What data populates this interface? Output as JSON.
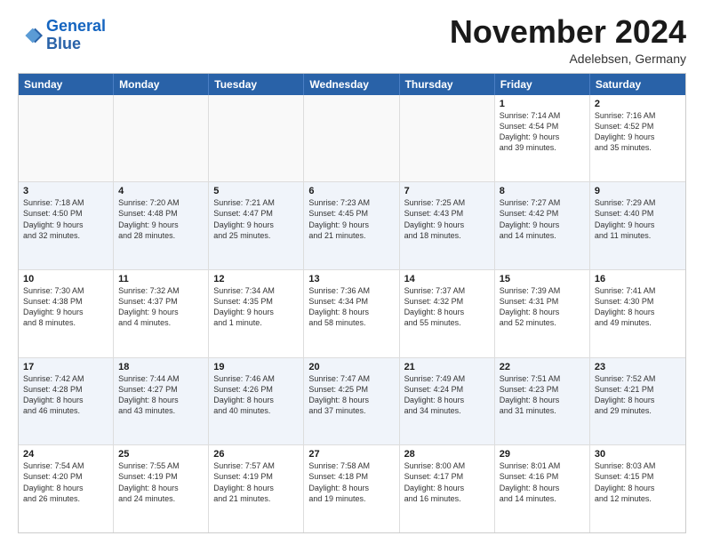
{
  "header": {
    "logo_line1": "General",
    "logo_line2": "Blue",
    "month": "November 2024",
    "location": "Adelebsen, Germany"
  },
  "weekdays": [
    "Sunday",
    "Monday",
    "Tuesday",
    "Wednesday",
    "Thursday",
    "Friday",
    "Saturday"
  ],
  "rows": [
    [
      {
        "day": "",
        "info": ""
      },
      {
        "day": "",
        "info": ""
      },
      {
        "day": "",
        "info": ""
      },
      {
        "day": "",
        "info": ""
      },
      {
        "day": "",
        "info": ""
      },
      {
        "day": "1",
        "info": "Sunrise: 7:14 AM\nSunset: 4:54 PM\nDaylight: 9 hours\nand 39 minutes."
      },
      {
        "day": "2",
        "info": "Sunrise: 7:16 AM\nSunset: 4:52 PM\nDaylight: 9 hours\nand 35 minutes."
      }
    ],
    [
      {
        "day": "3",
        "info": "Sunrise: 7:18 AM\nSunset: 4:50 PM\nDaylight: 9 hours\nand 32 minutes."
      },
      {
        "day": "4",
        "info": "Sunrise: 7:20 AM\nSunset: 4:48 PM\nDaylight: 9 hours\nand 28 minutes."
      },
      {
        "day": "5",
        "info": "Sunrise: 7:21 AM\nSunset: 4:47 PM\nDaylight: 9 hours\nand 25 minutes."
      },
      {
        "day": "6",
        "info": "Sunrise: 7:23 AM\nSunset: 4:45 PM\nDaylight: 9 hours\nand 21 minutes."
      },
      {
        "day": "7",
        "info": "Sunrise: 7:25 AM\nSunset: 4:43 PM\nDaylight: 9 hours\nand 18 minutes."
      },
      {
        "day": "8",
        "info": "Sunrise: 7:27 AM\nSunset: 4:42 PM\nDaylight: 9 hours\nand 14 minutes."
      },
      {
        "day": "9",
        "info": "Sunrise: 7:29 AM\nSunset: 4:40 PM\nDaylight: 9 hours\nand 11 minutes."
      }
    ],
    [
      {
        "day": "10",
        "info": "Sunrise: 7:30 AM\nSunset: 4:38 PM\nDaylight: 9 hours\nand 8 minutes."
      },
      {
        "day": "11",
        "info": "Sunrise: 7:32 AM\nSunset: 4:37 PM\nDaylight: 9 hours\nand 4 minutes."
      },
      {
        "day": "12",
        "info": "Sunrise: 7:34 AM\nSunset: 4:35 PM\nDaylight: 9 hours\nand 1 minute."
      },
      {
        "day": "13",
        "info": "Sunrise: 7:36 AM\nSunset: 4:34 PM\nDaylight: 8 hours\nand 58 minutes."
      },
      {
        "day": "14",
        "info": "Sunrise: 7:37 AM\nSunset: 4:32 PM\nDaylight: 8 hours\nand 55 minutes."
      },
      {
        "day": "15",
        "info": "Sunrise: 7:39 AM\nSunset: 4:31 PM\nDaylight: 8 hours\nand 52 minutes."
      },
      {
        "day": "16",
        "info": "Sunrise: 7:41 AM\nSunset: 4:30 PM\nDaylight: 8 hours\nand 49 minutes."
      }
    ],
    [
      {
        "day": "17",
        "info": "Sunrise: 7:42 AM\nSunset: 4:28 PM\nDaylight: 8 hours\nand 46 minutes."
      },
      {
        "day": "18",
        "info": "Sunrise: 7:44 AM\nSunset: 4:27 PM\nDaylight: 8 hours\nand 43 minutes."
      },
      {
        "day": "19",
        "info": "Sunrise: 7:46 AM\nSunset: 4:26 PM\nDaylight: 8 hours\nand 40 minutes."
      },
      {
        "day": "20",
        "info": "Sunrise: 7:47 AM\nSunset: 4:25 PM\nDaylight: 8 hours\nand 37 minutes."
      },
      {
        "day": "21",
        "info": "Sunrise: 7:49 AM\nSunset: 4:24 PM\nDaylight: 8 hours\nand 34 minutes."
      },
      {
        "day": "22",
        "info": "Sunrise: 7:51 AM\nSunset: 4:23 PM\nDaylight: 8 hours\nand 31 minutes."
      },
      {
        "day": "23",
        "info": "Sunrise: 7:52 AM\nSunset: 4:21 PM\nDaylight: 8 hours\nand 29 minutes."
      }
    ],
    [
      {
        "day": "24",
        "info": "Sunrise: 7:54 AM\nSunset: 4:20 PM\nDaylight: 8 hours\nand 26 minutes."
      },
      {
        "day": "25",
        "info": "Sunrise: 7:55 AM\nSunset: 4:19 PM\nDaylight: 8 hours\nand 24 minutes."
      },
      {
        "day": "26",
        "info": "Sunrise: 7:57 AM\nSunset: 4:19 PM\nDaylight: 8 hours\nand 21 minutes."
      },
      {
        "day": "27",
        "info": "Sunrise: 7:58 AM\nSunset: 4:18 PM\nDaylight: 8 hours\nand 19 minutes."
      },
      {
        "day": "28",
        "info": "Sunrise: 8:00 AM\nSunset: 4:17 PM\nDaylight: 8 hours\nand 16 minutes."
      },
      {
        "day": "29",
        "info": "Sunrise: 8:01 AM\nSunset: 4:16 PM\nDaylight: 8 hours\nand 14 minutes."
      },
      {
        "day": "30",
        "info": "Sunrise: 8:03 AM\nSunset: 4:15 PM\nDaylight: 8 hours\nand 12 minutes."
      }
    ]
  ]
}
